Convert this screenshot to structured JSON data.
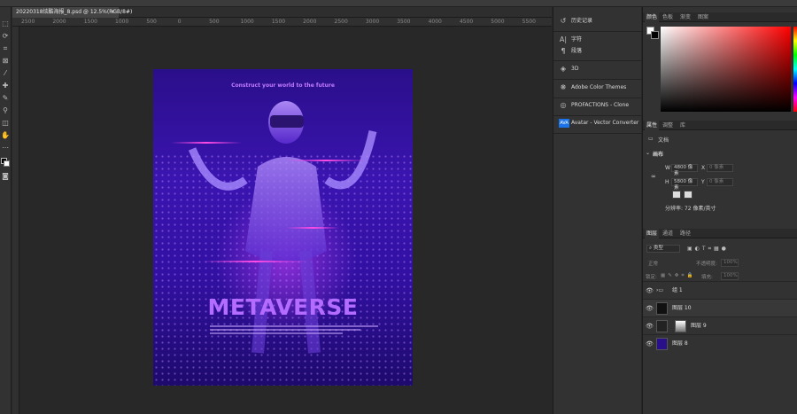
{
  "document": {
    "tab_title": "20220318炫酷海报_8.psd @ 12.5%(RGB/8#)",
    "tab_close": "×",
    "tagline": "Construct your world to the future",
    "headline": "METAVERSE"
  },
  "rulers": {
    "top": [
      "2500",
      "2000",
      "1500",
      "1000",
      "500",
      "0",
      "500",
      "1000",
      "1500",
      "2000",
      "2500",
      "3000",
      "3500",
      "4000",
      "4500",
      "5000",
      "5500"
    ]
  },
  "side_panel": {
    "items": [
      {
        "icon": "history-icon",
        "label": "历史记录"
      },
      {
        "icon": "character-icon",
        "label": "字符"
      },
      {
        "icon": "paragraph-icon",
        "label": "段落"
      },
      {
        "icon": "3d-icon",
        "label": "3D"
      },
      {
        "icon": "adobe-color-icon",
        "label": "Adobe Color Themes"
      },
      {
        "icon": "profactions-icon",
        "label": "PROFACTIONS - Clone"
      },
      {
        "icon": "ava-icon",
        "badge": "AVA",
        "label": "Avatar - Vector Converter"
      }
    ]
  },
  "color_panel": {
    "tabs": [
      "颜色",
      "色板",
      "渐变",
      "图案"
    ],
    "foreground": "#ffffff",
    "background": "#000000"
  },
  "properties_panel": {
    "tabs": [
      "属性",
      "调整",
      "库"
    ],
    "doc_label": "文档",
    "section": "画布",
    "w_label": "W",
    "w_value": "4800 像素",
    "x_label": "X",
    "x_placeholder": "0 像素",
    "h_label": "H",
    "h_value": "5800 像素",
    "y_label": "Y",
    "y_placeholder": "0 像素",
    "resolution": "分辨率: 72 像素/英寸"
  },
  "layers_panel": {
    "tabs": [
      "图层",
      "通道",
      "路径"
    ],
    "filter_label": "类型",
    "blend_mode": "正常",
    "opacity_label": "不透明度:",
    "opacity_value": "100%",
    "lock_label": "锁定:",
    "fill_label": "填充:",
    "fill_value": "100%",
    "layers": [
      {
        "name": "组 1",
        "kind": "group"
      },
      {
        "name": "图层 10",
        "kind": "layer"
      },
      {
        "name": "图层 9",
        "kind": "masked"
      },
      {
        "name": "图层 8",
        "kind": "fill",
        "color": "#2a0f8a"
      }
    ]
  }
}
